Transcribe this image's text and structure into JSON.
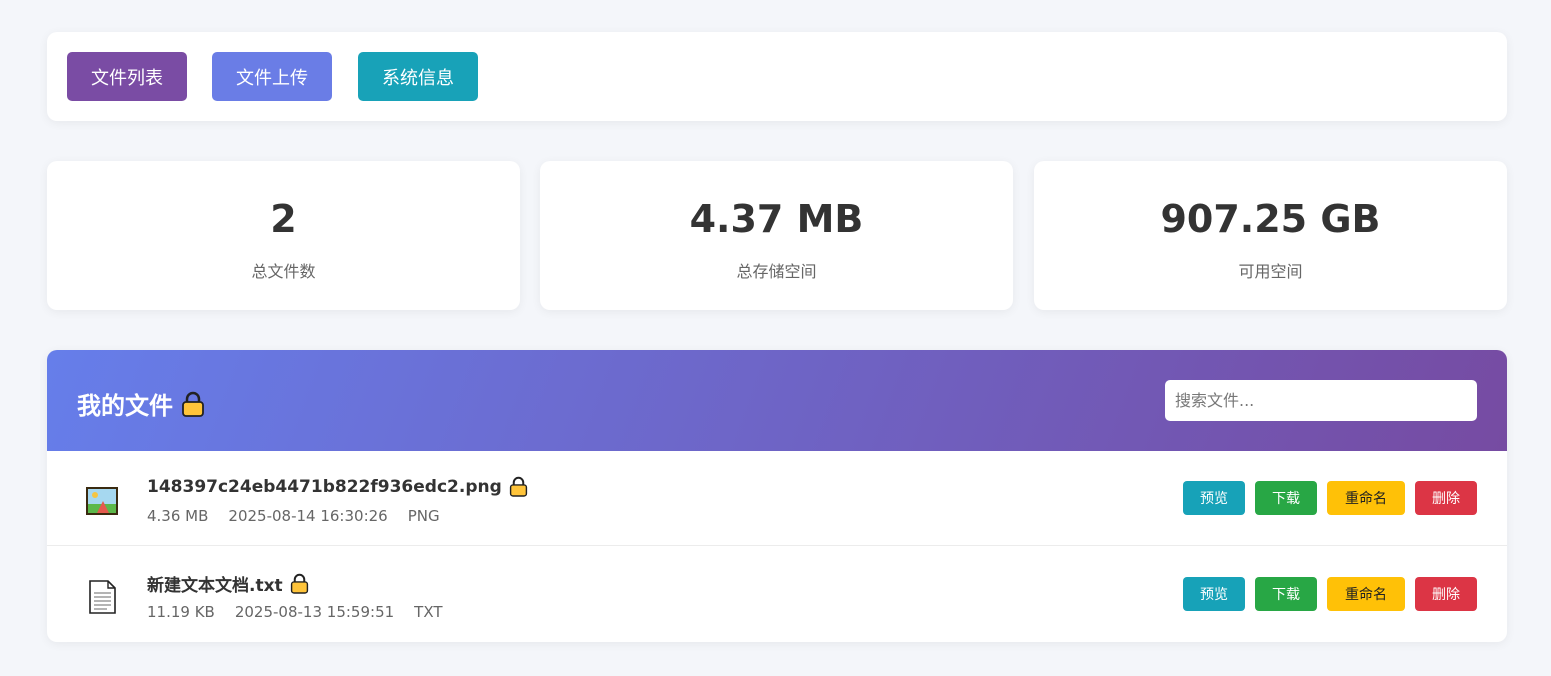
{
  "nav": {
    "items": [
      {
        "label": "文件列表",
        "color": "#7a4ca4"
      },
      {
        "label": "文件上传",
        "color": "#6a7de6"
      },
      {
        "label": "系统信息",
        "color": "#18a2b8"
      }
    ]
  },
  "stats": [
    {
      "value": "2",
      "label": "总文件数"
    },
    {
      "value": "4.37 MB",
      "label": "总存储空间"
    },
    {
      "value": "907.25 GB",
      "label": "可用空间"
    }
  ],
  "files_panel": {
    "title": "我的文件",
    "title_icon": "lock-icon",
    "gradient_start": "#667eea",
    "gradient_end": "#764ba2",
    "search_placeholder": "搜索文件..."
  },
  "files": [
    {
      "icon": "image-file-icon",
      "name": "148397c24eb4471b822f936edc2.png",
      "size": "4.36 MB",
      "date": "2025-08-14 16:30:26",
      "type": "PNG",
      "locked": true
    },
    {
      "icon": "text-file-icon",
      "name": "新建文本文档.txt",
      "size": "11.19 KB",
      "date": "2025-08-13 15:59:51",
      "type": "TXT",
      "locked": true
    }
  ],
  "actions": {
    "preview": {
      "label": "预览",
      "color": "#17a2b8"
    },
    "download": {
      "label": "下载",
      "color": "#28a745"
    },
    "rename": {
      "label": "重命名",
      "color": "#ffc107"
    },
    "delete": {
      "label": "删除",
      "color": "#dc3545"
    }
  }
}
